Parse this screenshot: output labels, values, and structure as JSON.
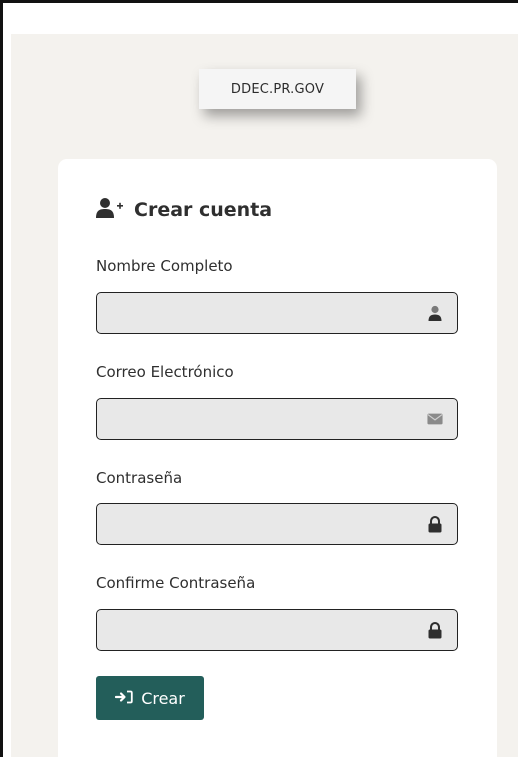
{
  "site": {
    "domain_label": "DDEC.PR.GOV"
  },
  "form": {
    "title": "Crear cuenta",
    "title_icon": "user-plus-icon",
    "fields": [
      {
        "label": "Nombre Completo",
        "value": "",
        "placeholder": "",
        "icon": "user-icon"
      },
      {
        "label": "Correo Electrónico",
        "value": "",
        "placeholder": "",
        "icon": "envelope-icon"
      },
      {
        "label": "Contraseña",
        "value": "",
        "placeholder": "",
        "icon": "lock-icon"
      },
      {
        "label": "Confirme Contraseña",
        "value": "",
        "placeholder": "",
        "icon": "lock-icon"
      }
    ],
    "submit_label": "Crear",
    "submit_icon": "sign-in-icon"
  },
  "colors": {
    "page_background": "#f4f2ee",
    "card_background": "#ffffff",
    "input_background": "#e8e8e8",
    "button_background": "#235e5a",
    "button_text": "#ffffff",
    "text": "#2f2f2f"
  }
}
